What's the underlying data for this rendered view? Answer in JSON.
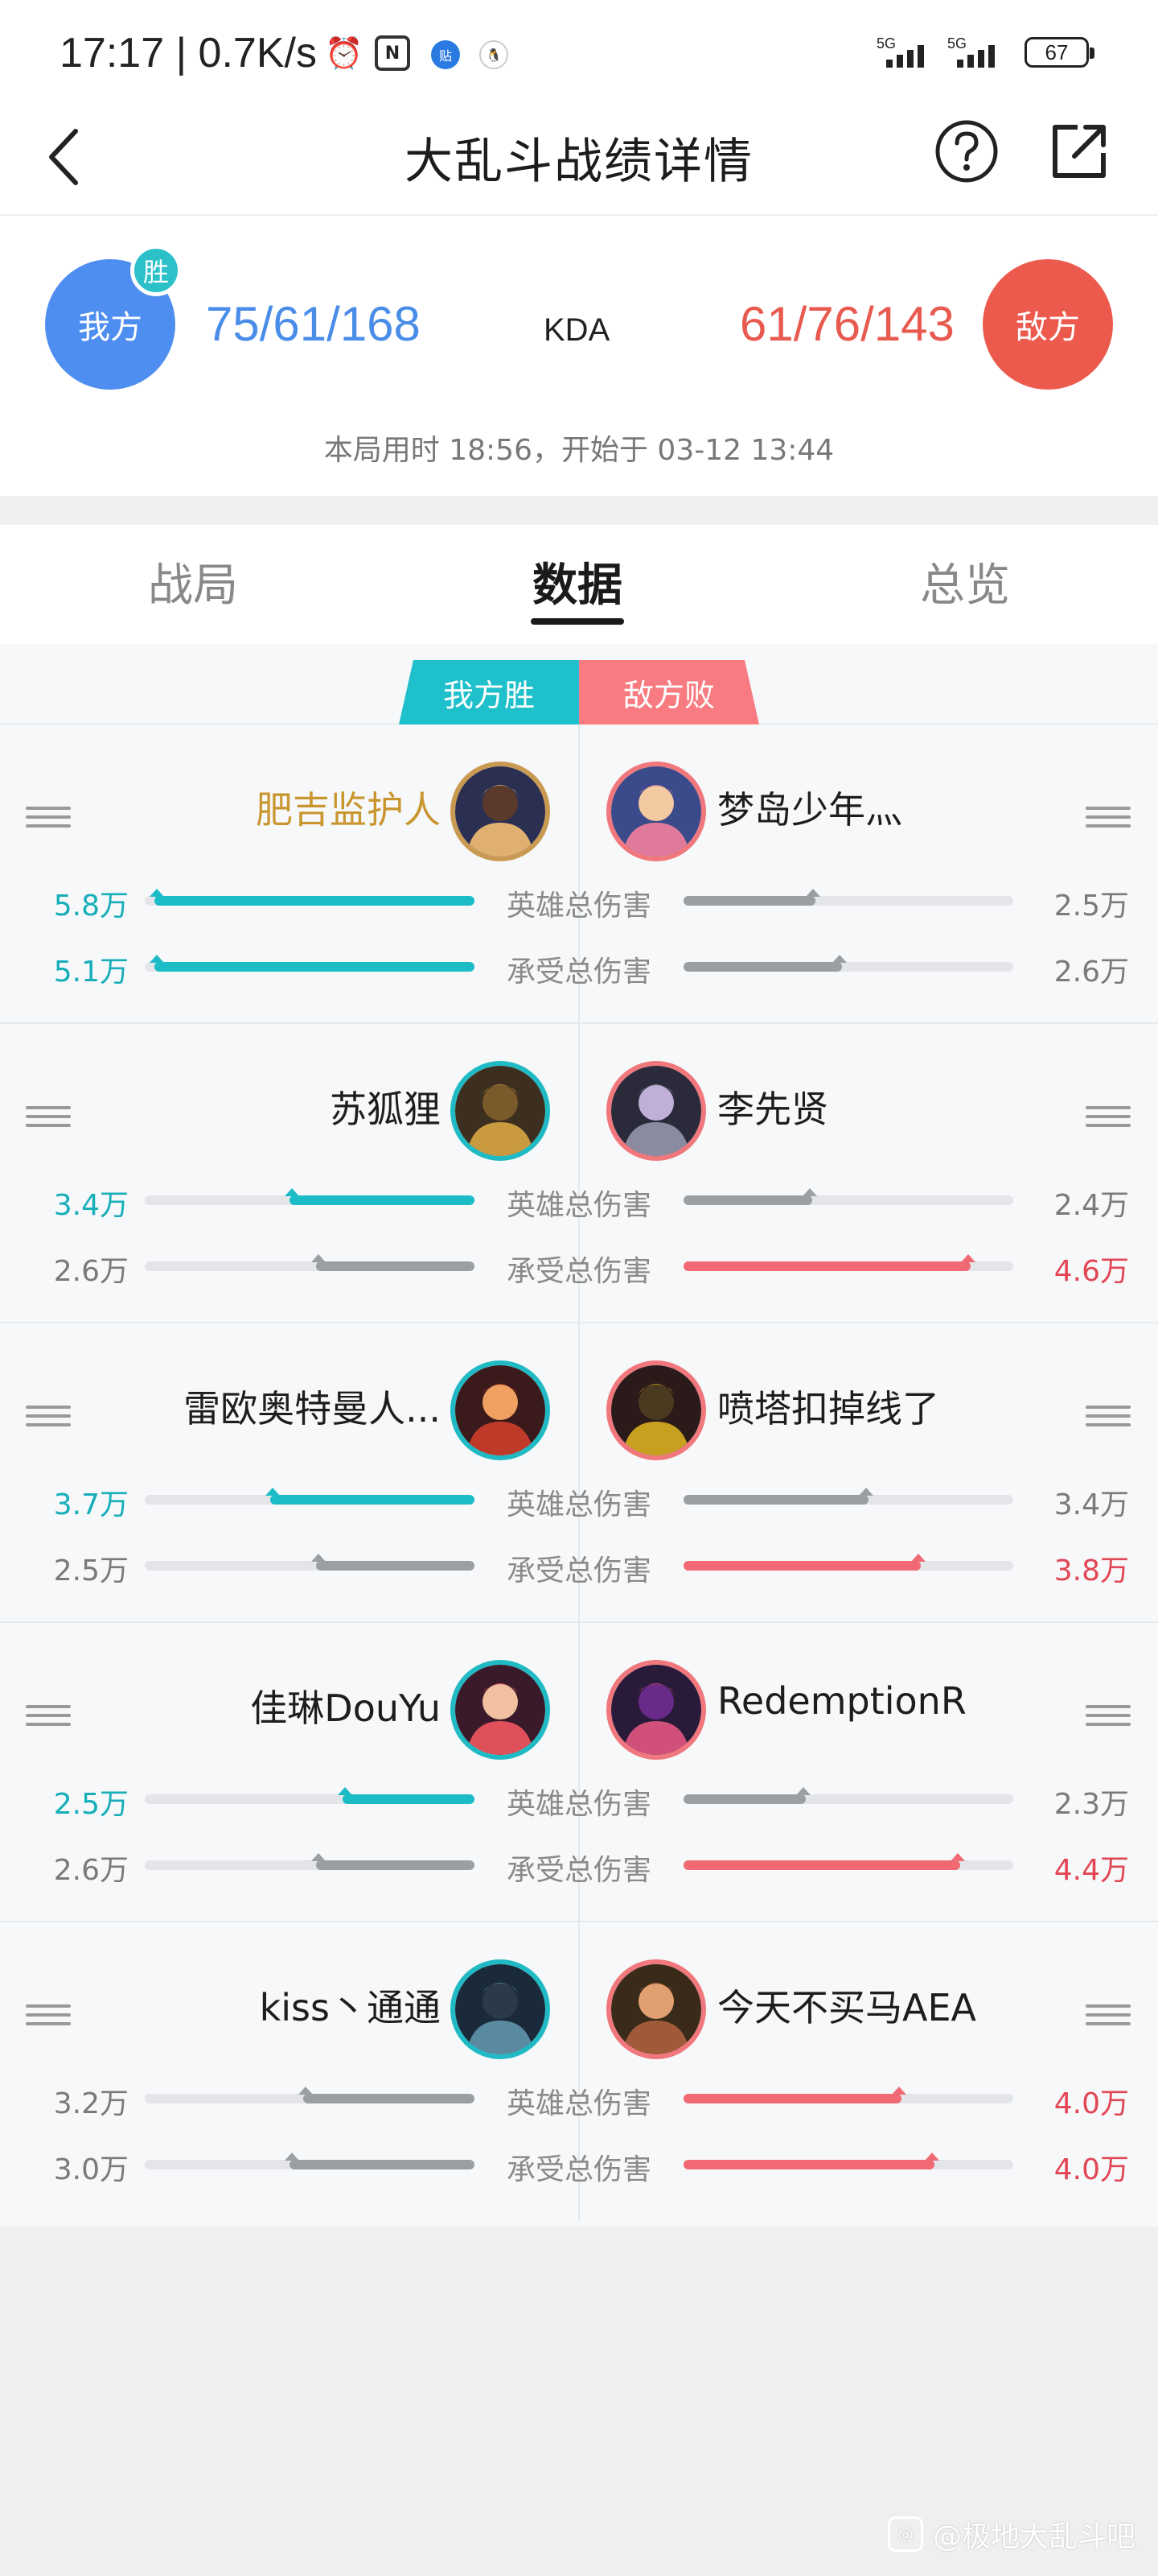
{
  "status_bar": {
    "time": "17:17 | 0.7K/s",
    "alarm_icon": "alarm-icon",
    "nfc_icon": "nfc-icon",
    "app_icon_1": "贴",
    "app_icon_2": "qq-icon",
    "signal_1_label": "5G",
    "signal_2_label": "5G",
    "battery": "67"
  },
  "header": {
    "title": "大乱斗战绩详情",
    "back_icon": "back-chevron-icon",
    "help_icon": "help-icon",
    "share_icon": "share-icon"
  },
  "score": {
    "ours_label": "我方",
    "win_badge": "胜",
    "ours_kda": "75/61/168",
    "kda_label": "KDA",
    "enemy_kda": "61/76/143",
    "enemy_label": "敌方",
    "match_info": "本局用时 18:56，开始于 03-12 13:44",
    "colors": {
      "ours": "#4e8ef0",
      "enemy": "#ec5a4e",
      "badge": "#2cc1c9"
    }
  },
  "tabs": [
    {
      "label": "战局",
      "active": false
    },
    {
      "label": "数据",
      "active": true
    },
    {
      "label": "总览",
      "active": false
    }
  ],
  "ribbon": {
    "win": "我方胜",
    "lose": "敌方败"
  },
  "stat_labels": {
    "damage": "英雄总伤害",
    "taken": "承受总伤害"
  },
  "rows": [
    {
      "left": {
        "name": "肥吉监护人",
        "name_highlight": true,
        "avatar": "champion-avatar-icon",
        "damage": {
          "value": "5.8万",
          "fraction": 0.97,
          "color": "teal",
          "highlight": true
        },
        "taken": {
          "value": "5.1万",
          "fraction": 0.97,
          "color": "teal",
          "highlight": true
        }
      },
      "right": {
        "name": "梦岛少年灬",
        "avatar": "champion-avatar-icon",
        "damage": {
          "value": "2.5万",
          "fraction": 0.4,
          "color": "gray",
          "highlight": false
        },
        "taken": {
          "value": "2.6万",
          "fraction": 0.48,
          "color": "gray",
          "highlight": false
        }
      }
    },
    {
      "left": {
        "name": "苏狐狸",
        "name_highlight": false,
        "avatar": "champion-avatar-icon",
        "damage": {
          "value": "3.4万",
          "fraction": 0.56,
          "color": "teal",
          "highlight": true
        },
        "taken": {
          "value": "2.6万",
          "fraction": 0.48,
          "color": "gray",
          "highlight": false
        }
      },
      "right": {
        "name": "李先贤",
        "avatar": "champion-avatar-icon",
        "damage": {
          "value": "2.4万",
          "fraction": 0.39,
          "color": "gray",
          "highlight": false
        },
        "taken": {
          "value": "4.6万",
          "fraction": 0.87,
          "color": "red",
          "highlight": true
        }
      }
    },
    {
      "left": {
        "name": "雷欧奥特曼人...",
        "name_highlight": false,
        "avatar": "champion-avatar-icon",
        "damage": {
          "value": "3.7万",
          "fraction": 0.62,
          "color": "teal",
          "highlight": true
        },
        "taken": {
          "value": "2.5万",
          "fraction": 0.48,
          "color": "gray",
          "highlight": false
        }
      },
      "right": {
        "name": "喷塔扣掉线了",
        "avatar": "champion-avatar-icon",
        "damage": {
          "value": "3.4万",
          "fraction": 0.56,
          "color": "gray",
          "highlight": false
        },
        "taken": {
          "value": "3.8万",
          "fraction": 0.72,
          "color": "red",
          "highlight": true
        }
      }
    },
    {
      "left": {
        "name": "佳琳DouYu",
        "name_highlight": false,
        "avatar": "champion-avatar-icon",
        "damage": {
          "value": "2.5万",
          "fraction": 0.4,
          "color": "teal",
          "highlight": true
        },
        "taken": {
          "value": "2.6万",
          "fraction": 0.48,
          "color": "gray",
          "highlight": false
        }
      },
      "right": {
        "name": "RedemptionR",
        "avatar": "champion-avatar-icon",
        "damage": {
          "value": "2.3万",
          "fraction": 0.37,
          "color": "gray",
          "highlight": false
        },
        "taken": {
          "value": "4.4万",
          "fraction": 0.84,
          "color": "red",
          "highlight": true
        }
      }
    },
    {
      "left": {
        "name": "kiss丶通通",
        "name_highlight": false,
        "avatar": "champion-avatar-icon",
        "damage": {
          "value": "3.2万",
          "fraction": 0.52,
          "color": "gray",
          "highlight": false
        },
        "taken": {
          "value": "3.0万",
          "fraction": 0.56,
          "color": "gray",
          "highlight": false
        }
      },
      "right": {
        "name": "今天不买马AEA",
        "avatar": "champion-avatar-icon",
        "damage": {
          "value": "4.0万",
          "fraction": 0.66,
          "color": "red",
          "highlight": true
        },
        "taken": {
          "value": "4.0万",
          "fraction": 0.76,
          "color": "red",
          "highlight": true
        }
      }
    }
  ],
  "watermark": "@极地大乱斗吧"
}
